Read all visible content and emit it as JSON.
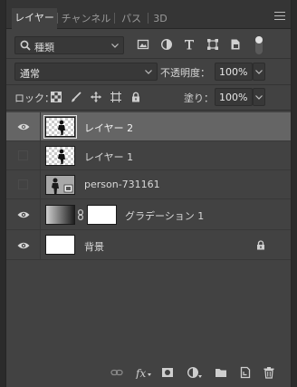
{
  "tabs": [
    {
      "label": "レイヤー",
      "active": true
    },
    {
      "label": "チャンネル",
      "active": false
    },
    {
      "label": "パス",
      "active": false
    },
    {
      "label": "3D",
      "active": false
    }
  ],
  "filter": {
    "kind_label": "種類",
    "icons": [
      "pixel-filter-icon",
      "adjustment-filter-icon",
      "type-filter-icon",
      "shape-filter-icon",
      "smart-object-filter-icon"
    ]
  },
  "blend": {
    "mode": "通常",
    "opacity_label": "不透明度：",
    "opacity_value": "100%"
  },
  "lock": {
    "label": "ロック：",
    "icons": [
      "lock-transparent-icon",
      "lock-image-icon",
      "lock-position-icon",
      "lock-artboard-icon",
      "lock-all-icon"
    ],
    "fill_label": "塗り：",
    "fill_value": "100%"
  },
  "layers": [
    {
      "name": "レイヤー 2",
      "visible": true,
      "selected": true,
      "type": "pixel"
    },
    {
      "name": "レイヤー 1",
      "visible": false,
      "selected": false,
      "type": "pixel"
    },
    {
      "name": "person-731161",
      "visible": false,
      "selected": false,
      "type": "smart-object"
    },
    {
      "name": "グラデーション 1",
      "visible": true,
      "selected": false,
      "type": "gradient-fill"
    },
    {
      "name": "背景",
      "visible": true,
      "selected": false,
      "type": "background",
      "locked": true
    }
  ],
  "footer_icons": [
    "link-layers-icon",
    "fx-icon",
    "add-mask-icon",
    "adjustment-layer-icon",
    "new-group-icon",
    "new-layer-icon",
    "delete-layer-icon"
  ],
  "colors": {
    "panel_bg": "#424242",
    "selected_row": "#656565",
    "tabbar_bg": "#353535"
  }
}
